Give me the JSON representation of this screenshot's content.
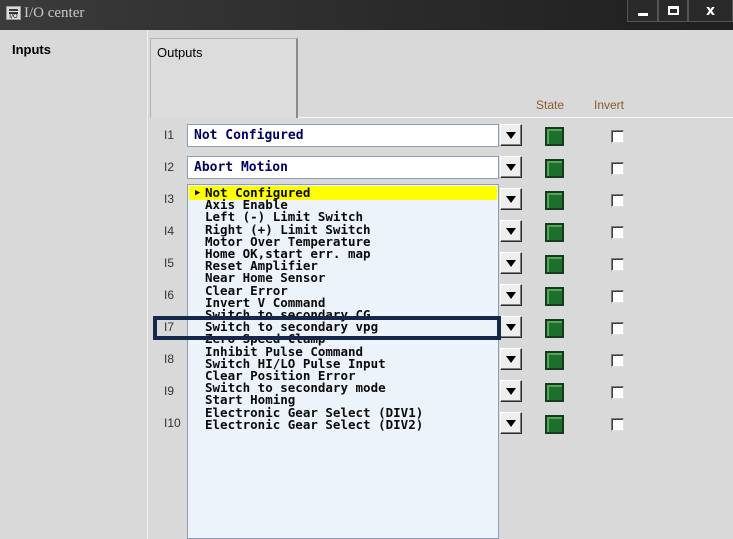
{
  "window": {
    "title": "I/O center",
    "icon": "io-app-icon",
    "icon_text": "I/O",
    "close_symbol": "x"
  },
  "tabs": {
    "inputs": "Inputs",
    "outputs": "Outputs"
  },
  "columns": {
    "state": "State",
    "invert": "Invert"
  },
  "rows": [
    {
      "label": "I1",
      "value": "Not Configured",
      "state": "on",
      "invert": false
    },
    {
      "label": "I2",
      "value": "Abort Motion",
      "state": "on",
      "invert": false
    },
    {
      "label": "I3",
      "value": "",
      "state": "on",
      "invert": false
    },
    {
      "label": "I4",
      "value": "",
      "state": "on",
      "invert": false
    },
    {
      "label": "I5",
      "value": "",
      "state": "on",
      "invert": false
    },
    {
      "label": "I6",
      "value": "",
      "state": "on",
      "invert": false
    },
    {
      "label": "I7",
      "value": "",
      "state": "on",
      "invert": false
    },
    {
      "label": "I8",
      "value": "",
      "state": "on",
      "invert": false
    },
    {
      "label": "I9",
      "value": "",
      "state": "on",
      "invert": false
    },
    {
      "label": "I10",
      "value": "",
      "state": "on",
      "invert": false
    }
  ],
  "dropdown": {
    "selected_index": 0,
    "highlighted_option": "Near Home Sensor",
    "options": [
      "Not Configured",
      "Axis Enable",
      "Left (-) Limit Switch",
      "Right (+) Limit Switch",
      "Motor Over Temperature",
      "Home OK,start err. map",
      "Reset Amplifier",
      "Near Home Sensor",
      "Clear Error",
      "Invert V Command",
      "Switch to secondary CG",
      "Switch to secondary vpg",
      "Zero Speed Clamp",
      "Inhibit Pulse Command",
      "Switch HI/LO Pulse Input",
      "Clear Position Error",
      "Switch to secondary mode",
      "Start Homing",
      "Electronic Gear Select (DIV1)",
      "Electronic Gear Select (DIV2)"
    ]
  },
  "colors": {
    "led_on": "#1f6e2b",
    "selected_option": "#ffff00",
    "highlight_box": "#13284a",
    "column_header": "#8a5a2b"
  }
}
